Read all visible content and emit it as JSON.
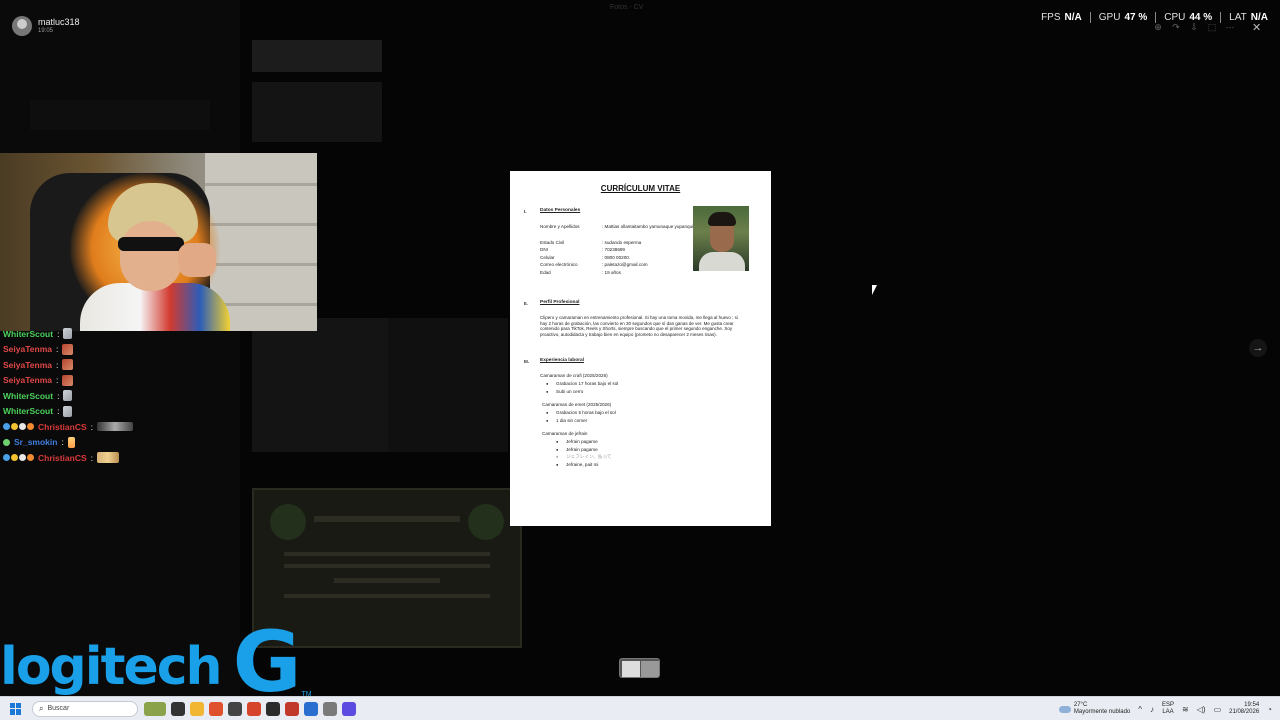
{
  "user": {
    "name": "matluc318",
    "time": "19:05"
  },
  "perf": {
    "fps_label": "FPS",
    "fps_value": "N/A",
    "gpu_label": "GPU",
    "gpu_value": "47 %",
    "cpu_label": "CPU",
    "cpu_value": "44 %",
    "lat_label": "LAT",
    "lat_value": "N/A"
  },
  "chat": [
    {
      "user": "WhiterScout",
      "color": "#4cd15b",
      "emote": "sword",
      "badges": []
    },
    {
      "user": "SeiyaTenma",
      "color": "#e04848",
      "emote": "red",
      "badges": []
    },
    {
      "user": "SeiyaTenma",
      "color": "#e04848",
      "emote": "red",
      "badges": []
    },
    {
      "user": "SeiyaTenma",
      "color": "#e04848",
      "emote": "red",
      "badges": []
    },
    {
      "user": "WhiterScout",
      "color": "#4cd15b",
      "emote": "sword",
      "badges": []
    },
    {
      "user": "WhiterScout",
      "color": "#4cd15b",
      "emote": "sword",
      "badges": []
    },
    {
      "user": "ChristianCS",
      "color": "#d93a3a",
      "emote": "bar",
      "badges": [
        "#4aa0e8",
        "#f2c230",
        "#e8e8e8",
        "#f28b30"
      ]
    },
    {
      "user": "Sr_smokin",
      "color": "#3f7fe0",
      "emote": "fire",
      "badges": [
        "#6fd06f"
      ]
    },
    {
      "user": "ChristianCS",
      "color": "#d93a3a",
      "emote": "trio",
      "badges": [
        "#4aa0e8",
        "#f2c230",
        "#e8e8e8",
        "#f28b30"
      ]
    }
  ],
  "logo": {
    "word": "logitech",
    "g": "G",
    "tm": "TM"
  },
  "document": {
    "title": "CURRÍCULUM VITAE",
    "sections": {
      "personal": {
        "num": "I.",
        "title": "Datos Personales"
      },
      "profile": {
        "num": "II.",
        "title": "Perfil Profesional"
      },
      "experience": {
        "num": "III.",
        "title": "Experiencia laboral"
      }
    },
    "personal_fields": [
      {
        "label": "Nombre y Apellidos",
        "value": ": Mattias ollantaitambo yamunaque yupanqui"
      },
      {
        "label": "Estado Civil",
        "value": ": sudando esperma"
      },
      {
        "label": "DNI",
        "value": ": 70238689"
      },
      {
        "label": "Celular",
        "value": ": 0800 00200."
      },
      {
        "label": "Correo electrónico",
        "value": ": paletazo@gmail.com"
      },
      {
        "label": "Edad",
        "value": ": 19 años"
      }
    ],
    "profile_text": "Clipero y camaraman en entrenamiento profesional. Si hay una toma movida, me llega al huevo ; si hay 2 horas de grabación, las convierto en 30 segundos que sí dan ganas de ver. Me gusta crear contenido para TikTok, Reels y Shorts, siempre buscando que el primer segundo enganche. Soy proactivo, autodidacta y trabajo bien en equipo (prometo no desaparecer 2 meses risas).",
    "jobs": [
      {
        "title": "Camaraman de crafi (2025/2026)",
        "bullets": [
          "Grabacion 17 horas bajo el sol",
          "Subi un cerro"
        ]
      },
      {
        "title": "Camaraman de emet (2025/2026)",
        "bullets": [
          "Grabacion 5 horas bajo el sol",
          "1 dia sin comer"
        ]
      },
      {
        "title": "Camaraman de jefrain",
        "bullets": [
          "Jefrain pagame",
          "Jefrain pagame",
          "ジェフレイン、払って",
          "Jefraine, pait mi"
        ]
      }
    ]
  },
  "viewer": {
    "close": "✕",
    "next": "→",
    "toolbar_icons": [
      "⊕",
      "↷",
      "⇩",
      "⬚",
      "⋯"
    ],
    "title": "Fotos - CV"
  },
  "taskbar": {
    "search_placeholder": "Buscar",
    "weather_temp": "27°C",
    "weather_desc": "Mayormente nublado",
    "lang_top": "ESP",
    "lang_bottom": "LAA",
    "time": "19:54",
    "date": "21/08/2026",
    "app_icon_colors": [
      "#8aa34a",
      "#333",
      "#f2b632",
      "#e0502c",
      "#444",
      "#d6442b",
      "#2b2b2b",
      "#c0392b",
      "#2a6fcf",
      "#7a7a7a",
      "#5b4be0"
    ]
  }
}
